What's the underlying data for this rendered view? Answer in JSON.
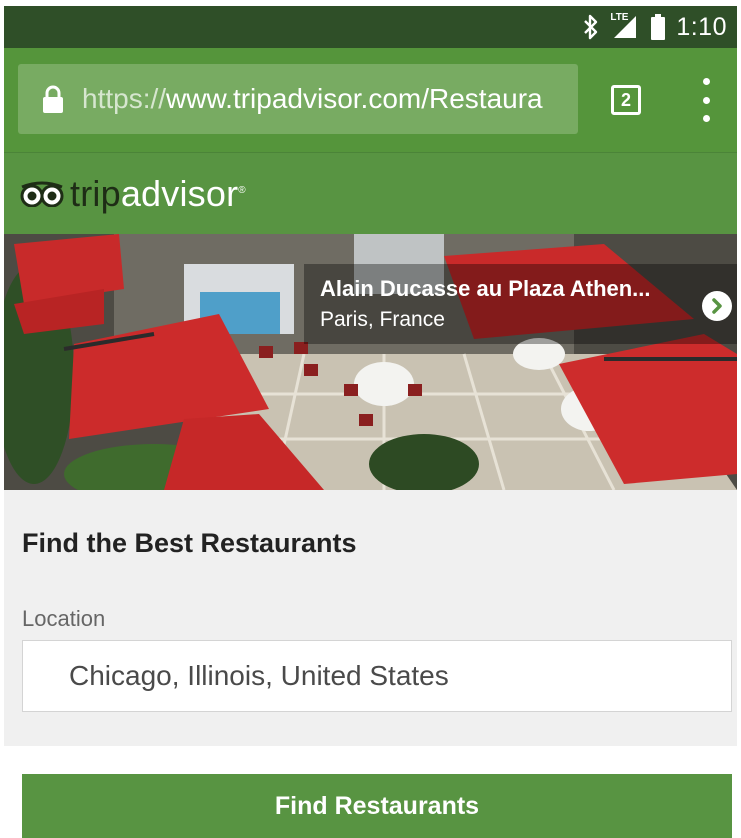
{
  "status_bar": {
    "time": "1:10",
    "network": "LTE",
    "icons": [
      "bluetooth-icon",
      "signal-icon",
      "battery-icon"
    ]
  },
  "browser": {
    "url_scheme": "https://",
    "url_rest": "www.tripadvisor.com/Restaura",
    "tab_count": "2",
    "icons": [
      "lock-icon",
      "tabs-icon",
      "overflow-menu-icon"
    ],
    "theme_color": "#55953b"
  },
  "header": {
    "brand_trip": "trip",
    "brand_advisor": "advisor",
    "reg_mark": "®",
    "brand_color": "#589442",
    "icon": "owl-eyes-icon"
  },
  "hero": {
    "restaurant_name": "Alain Ducasse au Plaza Athen...",
    "location": "Paris, France",
    "next_icon": "chevron-right-icon"
  },
  "form": {
    "title": "Find the Best Restaurants",
    "location_label": "Location",
    "location_value": "Chicago, Illinois, United States"
  },
  "cta": {
    "label": "Find Restaurants",
    "color": "#589442"
  }
}
